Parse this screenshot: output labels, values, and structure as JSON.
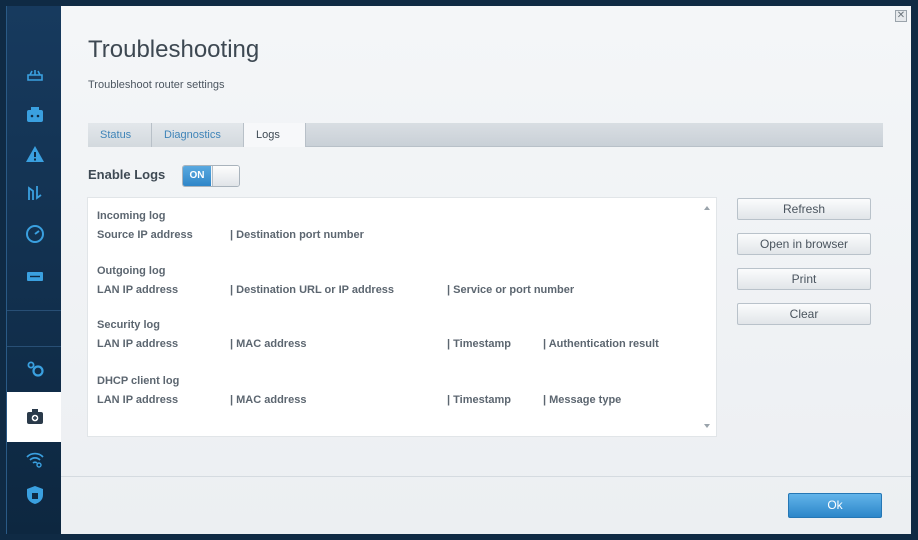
{
  "page": {
    "title": "Troubleshooting",
    "subtitle": "Troubleshoot router settings",
    "close_glyph": "✕"
  },
  "tabs": [
    {
      "label": "Status"
    },
    {
      "label": "Diagnostics"
    },
    {
      "label": "Logs"
    }
  ],
  "enable_logs": {
    "label": "Enable Logs",
    "state": "ON"
  },
  "logs": [
    {
      "title": "Incoming log",
      "columns": [
        "Source IP address",
        "|  Destination port number"
      ]
    },
    {
      "title": "Outgoing log",
      "columns": [
        "LAN IP address",
        "|  Destination URL or IP address",
        "|  Service or port number"
      ]
    },
    {
      "title": "Security log",
      "columns": [
        "LAN IP address",
        "|  MAC address",
        "|  Timestamp",
        "|  Authentication result"
      ]
    },
    {
      "title": "DHCP client log",
      "columns": [
        "LAN IP address",
        "|  MAC address",
        "|  Timestamp",
        "|  Message type"
      ]
    }
  ],
  "buttons": {
    "refresh": "Refresh",
    "open_in_browser": "Open in browser",
    "print": "Print",
    "clear": "Clear",
    "ok": "Ok"
  },
  "colors": {
    "accent": "#2f86c8",
    "sidebar": "#173a5e"
  },
  "sidebar_icons": [
    "router-icon",
    "network-map-icon",
    "warning-icon",
    "connectivity-icon",
    "speed-test-icon",
    "usb-storage-icon",
    "settings-gears-icon",
    "troubleshooting-icon",
    "wireless-icon",
    "security-icon"
  ]
}
